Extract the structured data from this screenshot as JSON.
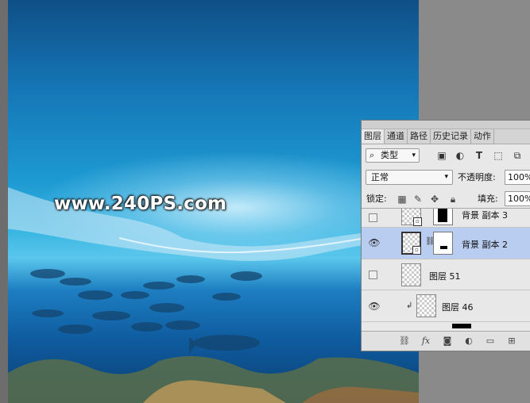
{
  "watermark": "www.240PS.com",
  "panel": {
    "tabs": [
      "图层",
      "通道",
      "路径",
      "历史记录",
      "动作"
    ],
    "filter": {
      "mag": "⌕",
      "label": "类型",
      "caret": "▾"
    },
    "filter_icons": [
      "image-filter-icon",
      "adjustment-filter-icon",
      "type-filter-icon",
      "shape-filter-icon",
      "smart-object-filter-icon"
    ],
    "blend_mode": "正常",
    "blend_caret": "▾",
    "opacity_label": "不透明度:",
    "opacity_value": "100%",
    "lock_label": "锁定:",
    "fill_label": "填充:",
    "fill_value": "100%",
    "layers": [
      {
        "name": "背景 副本 3",
        "visible": false
      },
      {
        "name": "背景 副本 2",
        "visible": true,
        "selected": true
      },
      {
        "name": "图层 51",
        "visible": false
      },
      {
        "name": "图层 46",
        "visible": true,
        "clipped": true
      }
    ],
    "bottom_icons": [
      "link-icon",
      "fx-icon",
      "add-mask-icon",
      "adjustment-layer-icon",
      "group-folder-icon",
      "new-layer-icon"
    ]
  },
  "colors": {
    "selected_row": "#b9cdf0",
    "panel_bg": "#e8e8e8",
    "workspace": "#8a8a8a"
  }
}
